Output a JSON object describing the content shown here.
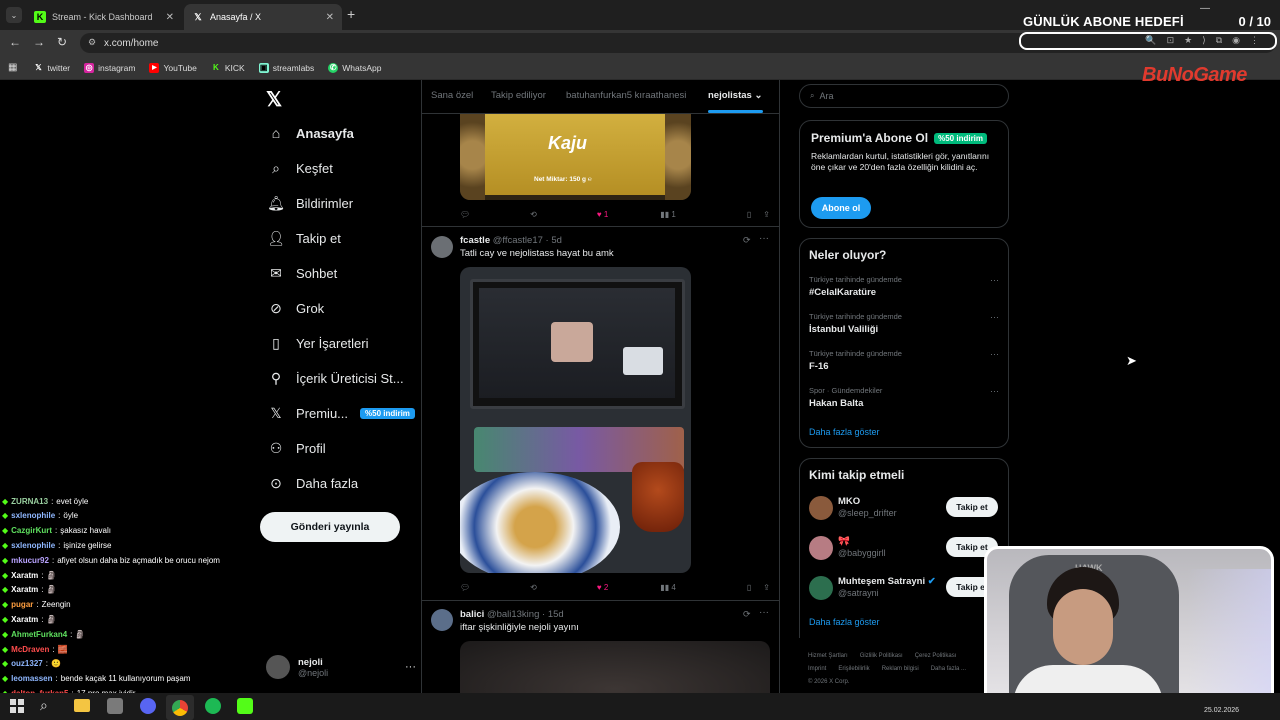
{
  "browser": {
    "tabs": [
      {
        "label": "Stream - Kick Dashboard",
        "icon": "kick-icon",
        "active": false
      },
      {
        "label": "Anasayfa / X",
        "icon": "x-icon",
        "active": true
      }
    ],
    "url": "x.com/home",
    "bookmarks": [
      "twitter",
      "instagram",
      "YouTube",
      "KICK",
      "streamlabs",
      "WhatsApp"
    ]
  },
  "overlay": {
    "goal_title": "GÜNLÜK ABONE HEDEFİ",
    "goal_count": "0",
    "goal_target": "/ 10",
    "goal_progress": 0,
    "brand": "BuNoGame"
  },
  "sidebar": {
    "items": [
      {
        "label": "Anasayfa",
        "icon": "home-icon",
        "bold": true
      },
      {
        "label": "Keşfet",
        "icon": "search-icon"
      },
      {
        "label": "Bildirimler",
        "icon": "bell-icon"
      },
      {
        "label": "Takip et",
        "icon": "person-add-icon"
      },
      {
        "label": "Sohbet",
        "icon": "mail-icon"
      },
      {
        "label": "Grok",
        "icon": "grok-icon"
      },
      {
        "label": "Yer İşaretleri",
        "icon": "bookmark-icon"
      },
      {
        "label": "İçerik Üreticisi St...",
        "icon": "creator-icon"
      },
      {
        "label": "Premiu...",
        "icon": "x-premium-icon",
        "badge": "%50 indirim"
      },
      {
        "label": "Profil",
        "icon": "profile-icon"
      },
      {
        "label": "Daha fazla",
        "icon": "more-circle-icon"
      }
    ],
    "post_button": "Gönderi yayınla",
    "account": {
      "name": "nejoli",
      "handle": "@nejoli"
    }
  },
  "timeline": {
    "tabs": [
      "Sana özel",
      "Takip ediliyor",
      "batuhanfurkan5 kıraathanesi",
      "nejolistas"
    ],
    "active_tab": "nejolistas",
    "top_image_text": {
      "brand": "Kaju",
      "weight": "Net Miktar: 150 g ℮"
    },
    "top_actions": {
      "likes": "1",
      "views": "1"
    },
    "tweets": [
      {
        "name": "fcastle",
        "handle": "@ffcastle17",
        "time": "5d",
        "text": "Tatli cay ve nejolistass hayat bu amk",
        "likes": "2",
        "views": "4"
      },
      {
        "name": "balici",
        "handle": "@bali13king",
        "time": "15d",
        "text": "iftar şişkinliğiyle nejoli yayını"
      }
    ]
  },
  "right": {
    "search_placeholder": "Ara",
    "premium": {
      "title": "Premium'a Abone Ol",
      "badge": "%50 indirim",
      "desc": "Reklamlardan kurtul, istatistikleri gör, yanıtlarını öne çıkar ve 20'den fazla özelliğin kilidini aç.",
      "button": "Abone ol"
    },
    "trends": {
      "title": "Neler oluyor?",
      "items": [
        {
          "category": "Türkiye tarihinde gündemde",
          "name": "#CelalKaratüre"
        },
        {
          "category": "Türkiye tarihinde gündemde",
          "name": "İstanbul Valiliği"
        },
        {
          "category": "Türkiye tarihinde gündemde",
          "name": "F-16"
        },
        {
          "category": "Spor · Gündemdekiler",
          "name": "Hakan Balta"
        }
      ],
      "more": "Daha fazla göster"
    },
    "who_to_follow": {
      "title": "Kimi takip etmeli",
      "users": [
        {
          "name": "MKO",
          "handle": "@sleep_drifter",
          "button": "Takip et"
        },
        {
          "name": "🎀",
          "handle": "@babyggirll",
          "button": "Takip et"
        },
        {
          "name": "Muhteşem Satrayni",
          "handle": "@satrayni",
          "button": "Takip et",
          "verified": true
        }
      ],
      "more": "Daha fazla göster"
    },
    "footer": {
      "line1": [
        "Hizmet Şartları",
        "Gizlilik Politikası",
        "Çerez Politikası"
      ],
      "line2": [
        "Imprint",
        "Erişilebilirlik",
        "Reklam bilgisi",
        "Daha fazla ..."
      ],
      "copyright": "© 2026 X Corp."
    }
  },
  "chat": [
    {
      "user": "ZURNA13",
      "msg": "evet öyle",
      "color": "#9ad0a0"
    },
    {
      "user": "sxlenophile",
      "msg": "öyle",
      "color": "#8fb7ff"
    },
    {
      "user": "CazgirKurt",
      "msg": "şakasız havalı",
      "color": "#5fe05f"
    },
    {
      "user": "sxlenophile",
      "msg": "işinize gelirse",
      "color": "#8fb7ff"
    },
    {
      "user": "mkucur92",
      "msg": "afiyet olsun daha biz açmadık be orucu nejom",
      "color": "#b9a3ff"
    },
    {
      "user": "Xaratm",
      "msg": "🗿",
      "color": "#ffffff"
    },
    {
      "user": "Xaratm",
      "msg": "🗿",
      "color": "#ffffff"
    },
    {
      "user": "pugar",
      "msg": "Zeengin",
      "color": "#ff9f40"
    },
    {
      "user": "Xaratm",
      "msg": "🗿",
      "color": "#ffffff"
    },
    {
      "user": "AhmetFurkan4",
      "msg": "🗿",
      "color": "#5fe05f"
    },
    {
      "user": "McDraven",
      "msg": "🧱",
      "color": "#ff4d4d"
    },
    {
      "user": "ouz1327",
      "msg": "🙂",
      "color": "#8fb7ff"
    },
    {
      "user": "leomassen",
      "msg": "bende kaçak 11 kullanıyorum paşam",
      "color": "#8fb7ff"
    },
    {
      "user": "dalton_furkan5",
      "msg": "17 pro max iyidir",
      "color": "#ff4d4d"
    }
  ],
  "taskbar": {
    "date": "25.02.2026"
  },
  "colors": {
    "accent": "#1d9bf0",
    "like": "#f91880",
    "badge_green": "#00ba7c"
  }
}
